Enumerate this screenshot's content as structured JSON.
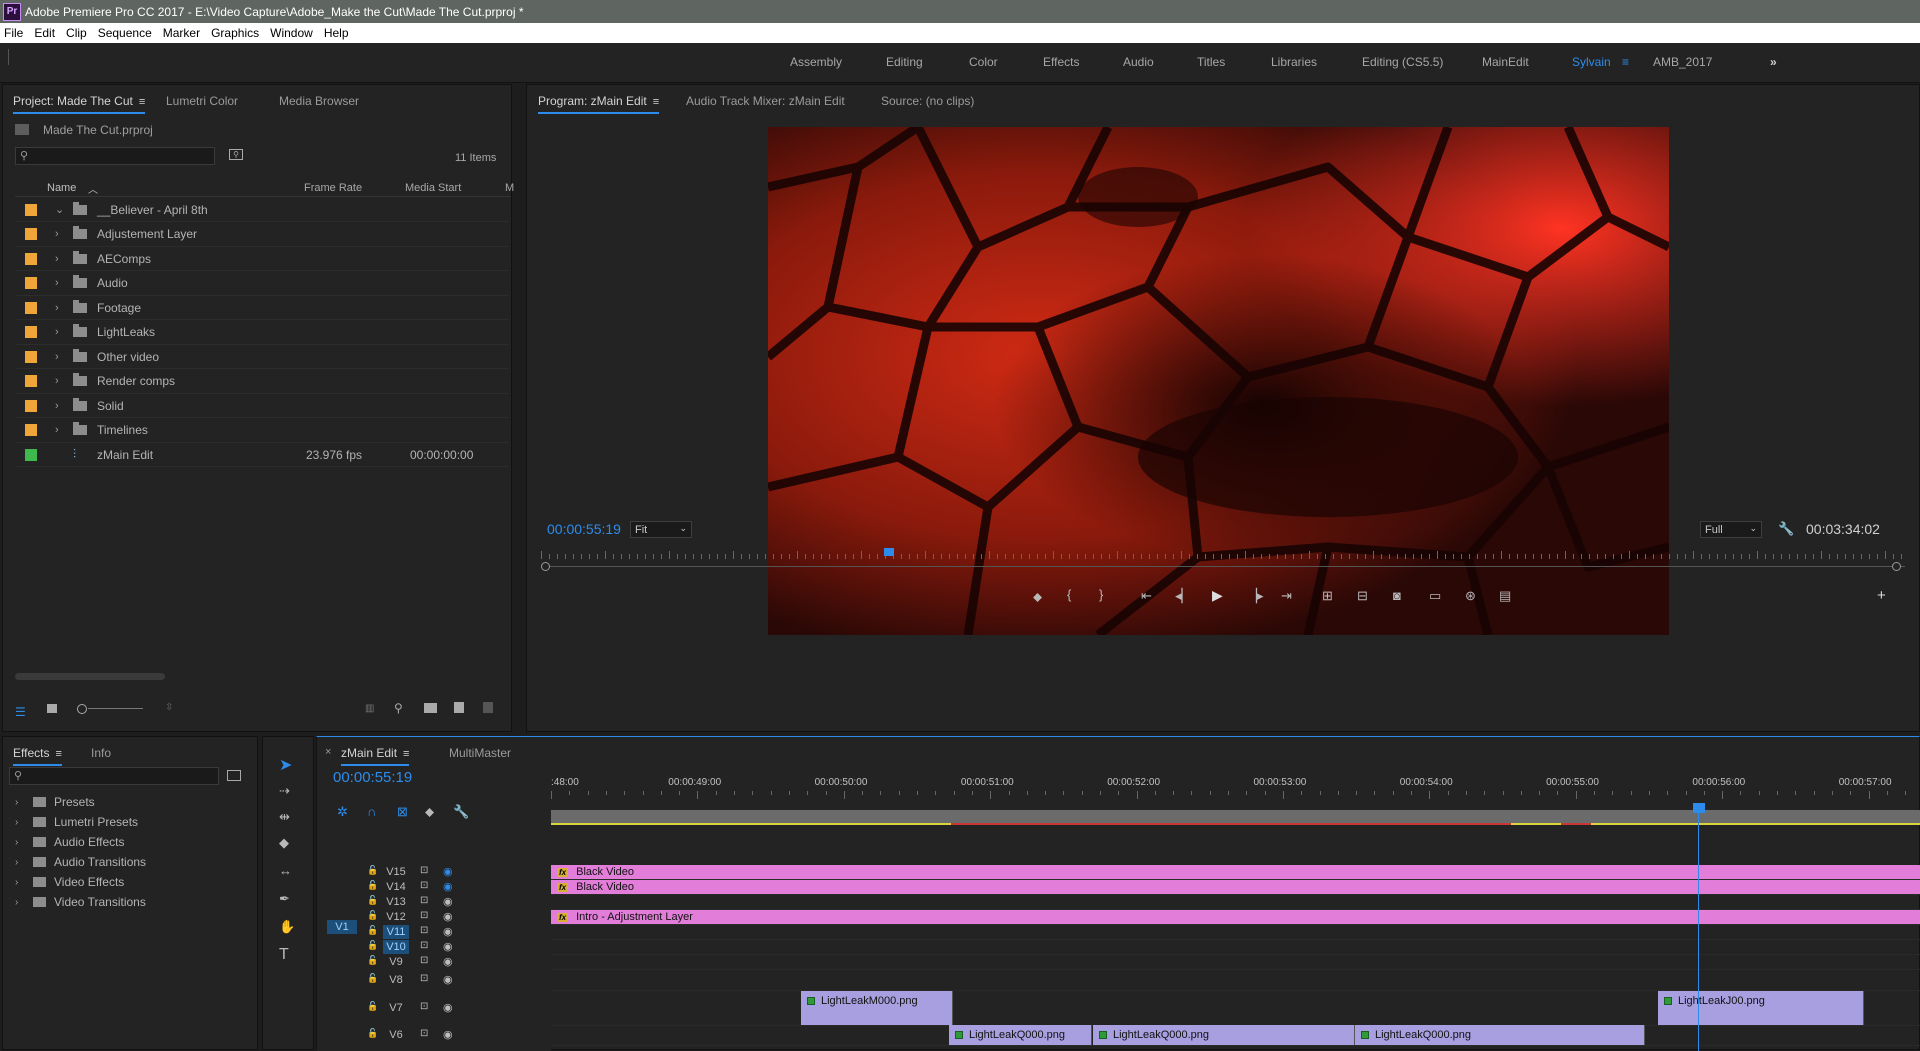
{
  "window": {
    "title": "Adobe Premiere Pro CC 2017 - E:\\Video Capture\\Adobe_Make the Cut\\Made The Cut.prproj *",
    "app_icon": "Pr"
  },
  "menu": [
    "File",
    "Edit",
    "Clip",
    "Sequence",
    "Marker",
    "Graphics",
    "Window",
    "Help"
  ],
  "workspaces": {
    "items": [
      "Assembly",
      "Editing",
      "Color",
      "Effects",
      "Audio",
      "Titles",
      "Libraries",
      "Editing (CS5.5)",
      "MainEdit",
      "Sylvain",
      "AMB_2017"
    ],
    "active": "Sylvain",
    "overflow_icon": "double-chevron-right-icon"
  },
  "project_panel": {
    "tabs": [
      "Project: Made The Cut",
      "Lumetri Color",
      "Media Browser"
    ],
    "project_file": "Made The Cut.prproj",
    "search_placeholder": "",
    "item_count": "11 Items",
    "columns": [
      "Name",
      "Frame Rate",
      "Media Start",
      "M"
    ],
    "items": [
      {
        "name": "__Believer - April 8th",
        "type": "bin",
        "expanded": true,
        "color": "#f0a53b"
      },
      {
        "name": "Adjustement Layer",
        "type": "bin",
        "color": "#f0a53b"
      },
      {
        "name": "AEComps",
        "type": "bin",
        "color": "#f0a53b"
      },
      {
        "name": "Audio",
        "type": "bin",
        "color": "#f0a53b"
      },
      {
        "name": "Footage",
        "type": "bin",
        "color": "#f0a53b"
      },
      {
        "name": "LightLeaks",
        "type": "bin",
        "color": "#f0a53b"
      },
      {
        "name": "Other video",
        "type": "bin",
        "color": "#f0a53b"
      },
      {
        "name": "Render comps",
        "type": "bin",
        "color": "#f0a53b"
      },
      {
        "name": "Solid",
        "type": "bin",
        "color": "#f0a53b"
      },
      {
        "name": "Timelines",
        "type": "bin",
        "color": "#f0a53b"
      },
      {
        "name": "zMain Edit",
        "type": "sequence",
        "frame_rate": "23.976 fps",
        "media_start": "00:00:00:00",
        "color": "#3fb94e"
      }
    ]
  },
  "program_monitor": {
    "tabs": [
      "Program: zMain Edit",
      "Audio Track Mixer: zMain Edit",
      "Source: (no clips)"
    ],
    "current_time": "00:00:55:19",
    "zoom": "Fit",
    "resolution": "Full",
    "duration": "00:03:34:02",
    "playhead_fraction": 0.255
  },
  "effects_panel": {
    "tabs": [
      "Effects",
      "Info"
    ],
    "items": [
      "Presets",
      "Lumetri Presets",
      "Audio Effects",
      "Audio Transitions",
      "Video Effects",
      "Video Transitions"
    ]
  },
  "timeline": {
    "tabs": [
      "zMain Edit",
      "MultiMaster"
    ],
    "current_time": "00:00:55:19",
    "ruler": [
      ":48:00",
      "00:00:49:00",
      "00:00:50:00",
      "00:00:51:00",
      "00:00:52:00",
      "00:00:53:00",
      "00:00:54:00",
      "00:00:55:00",
      "00:00:56:00",
      "00:00:57:00"
    ],
    "source_patch": "V1",
    "tracks": [
      "V15",
      "V14",
      "V13",
      "V12",
      "V11",
      "V10",
      "V9",
      "V8",
      "V7",
      "V6"
    ],
    "clips": [
      {
        "track": "V15",
        "name": "Black Video",
        "fx": "fx"
      },
      {
        "track": "V14",
        "name": "Black Video",
        "fx": "fx"
      },
      {
        "track": "V12",
        "name": "Intro - Adjustment Layer",
        "fx": "fx"
      },
      {
        "track": "V7",
        "name": "LightLeakM000.png"
      },
      {
        "track": "V7",
        "name": "LightLeakJ00.png"
      },
      {
        "track": "V6",
        "name": "LightLeakQ000.png"
      },
      {
        "track": "V6",
        "name": "LightLeakQ000.png"
      },
      {
        "track": "V6",
        "name": "LightLeakQ000.png"
      }
    ]
  },
  "colors": {
    "accent": "#2d8ceb",
    "clip_pink": "#e27ed9",
    "clip_purple": "#a79fdf"
  }
}
